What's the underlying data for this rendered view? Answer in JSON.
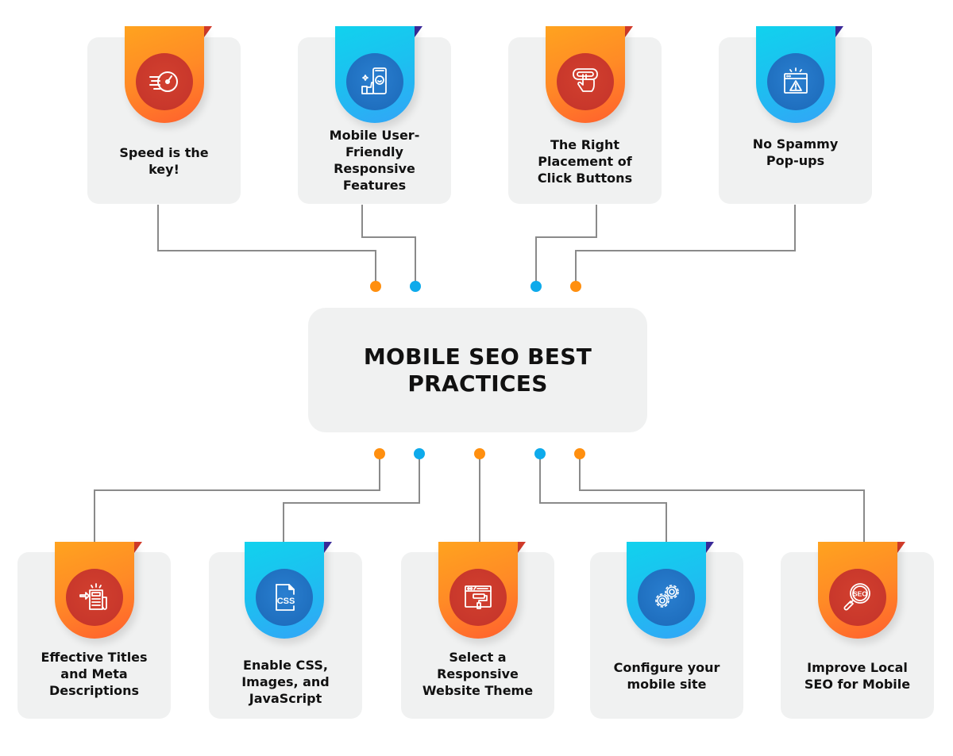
{
  "title": "MOBILE SEO BEST PRACTICES",
  "colors": {
    "orange": "#ff8f0f",
    "blue": "#0eaaeb",
    "card_bg": "#f0f1f1",
    "connector": "#8a8a8a",
    "text": "#111111"
  },
  "top_items": [
    {
      "label": "Speed is the key!",
      "theme": "orange",
      "icon": "speedometer-icon"
    },
    {
      "label": "Mobile User-Friendly Responsive Features",
      "theme": "blue",
      "icon": "mobile-thumbs-up-icon"
    },
    {
      "label": "The Right Placement of Click Buttons",
      "theme": "orange",
      "icon": "click-button-icon"
    },
    {
      "label": "No Spammy Pop-ups",
      "theme": "blue",
      "icon": "popup-warning-icon"
    }
  ],
  "bottom_items": [
    {
      "label": "Effective Titles and Meta Descriptions",
      "theme": "orange",
      "icon": "document-arrow-icon"
    },
    {
      "label": "Enable CSS, Images, and JavaScript",
      "theme": "blue",
      "icon": "css-file-icon"
    },
    {
      "label": "Select a Responsive Website Theme",
      "theme": "orange",
      "icon": "website-paint-roller-icon"
    },
    {
      "label": "Configure your mobile site",
      "theme": "blue",
      "icon": "gears-icon"
    },
    {
      "label": "Improve Local SEO for Mobile",
      "theme": "orange",
      "icon": "seo-magnifier-icon"
    }
  ]
}
